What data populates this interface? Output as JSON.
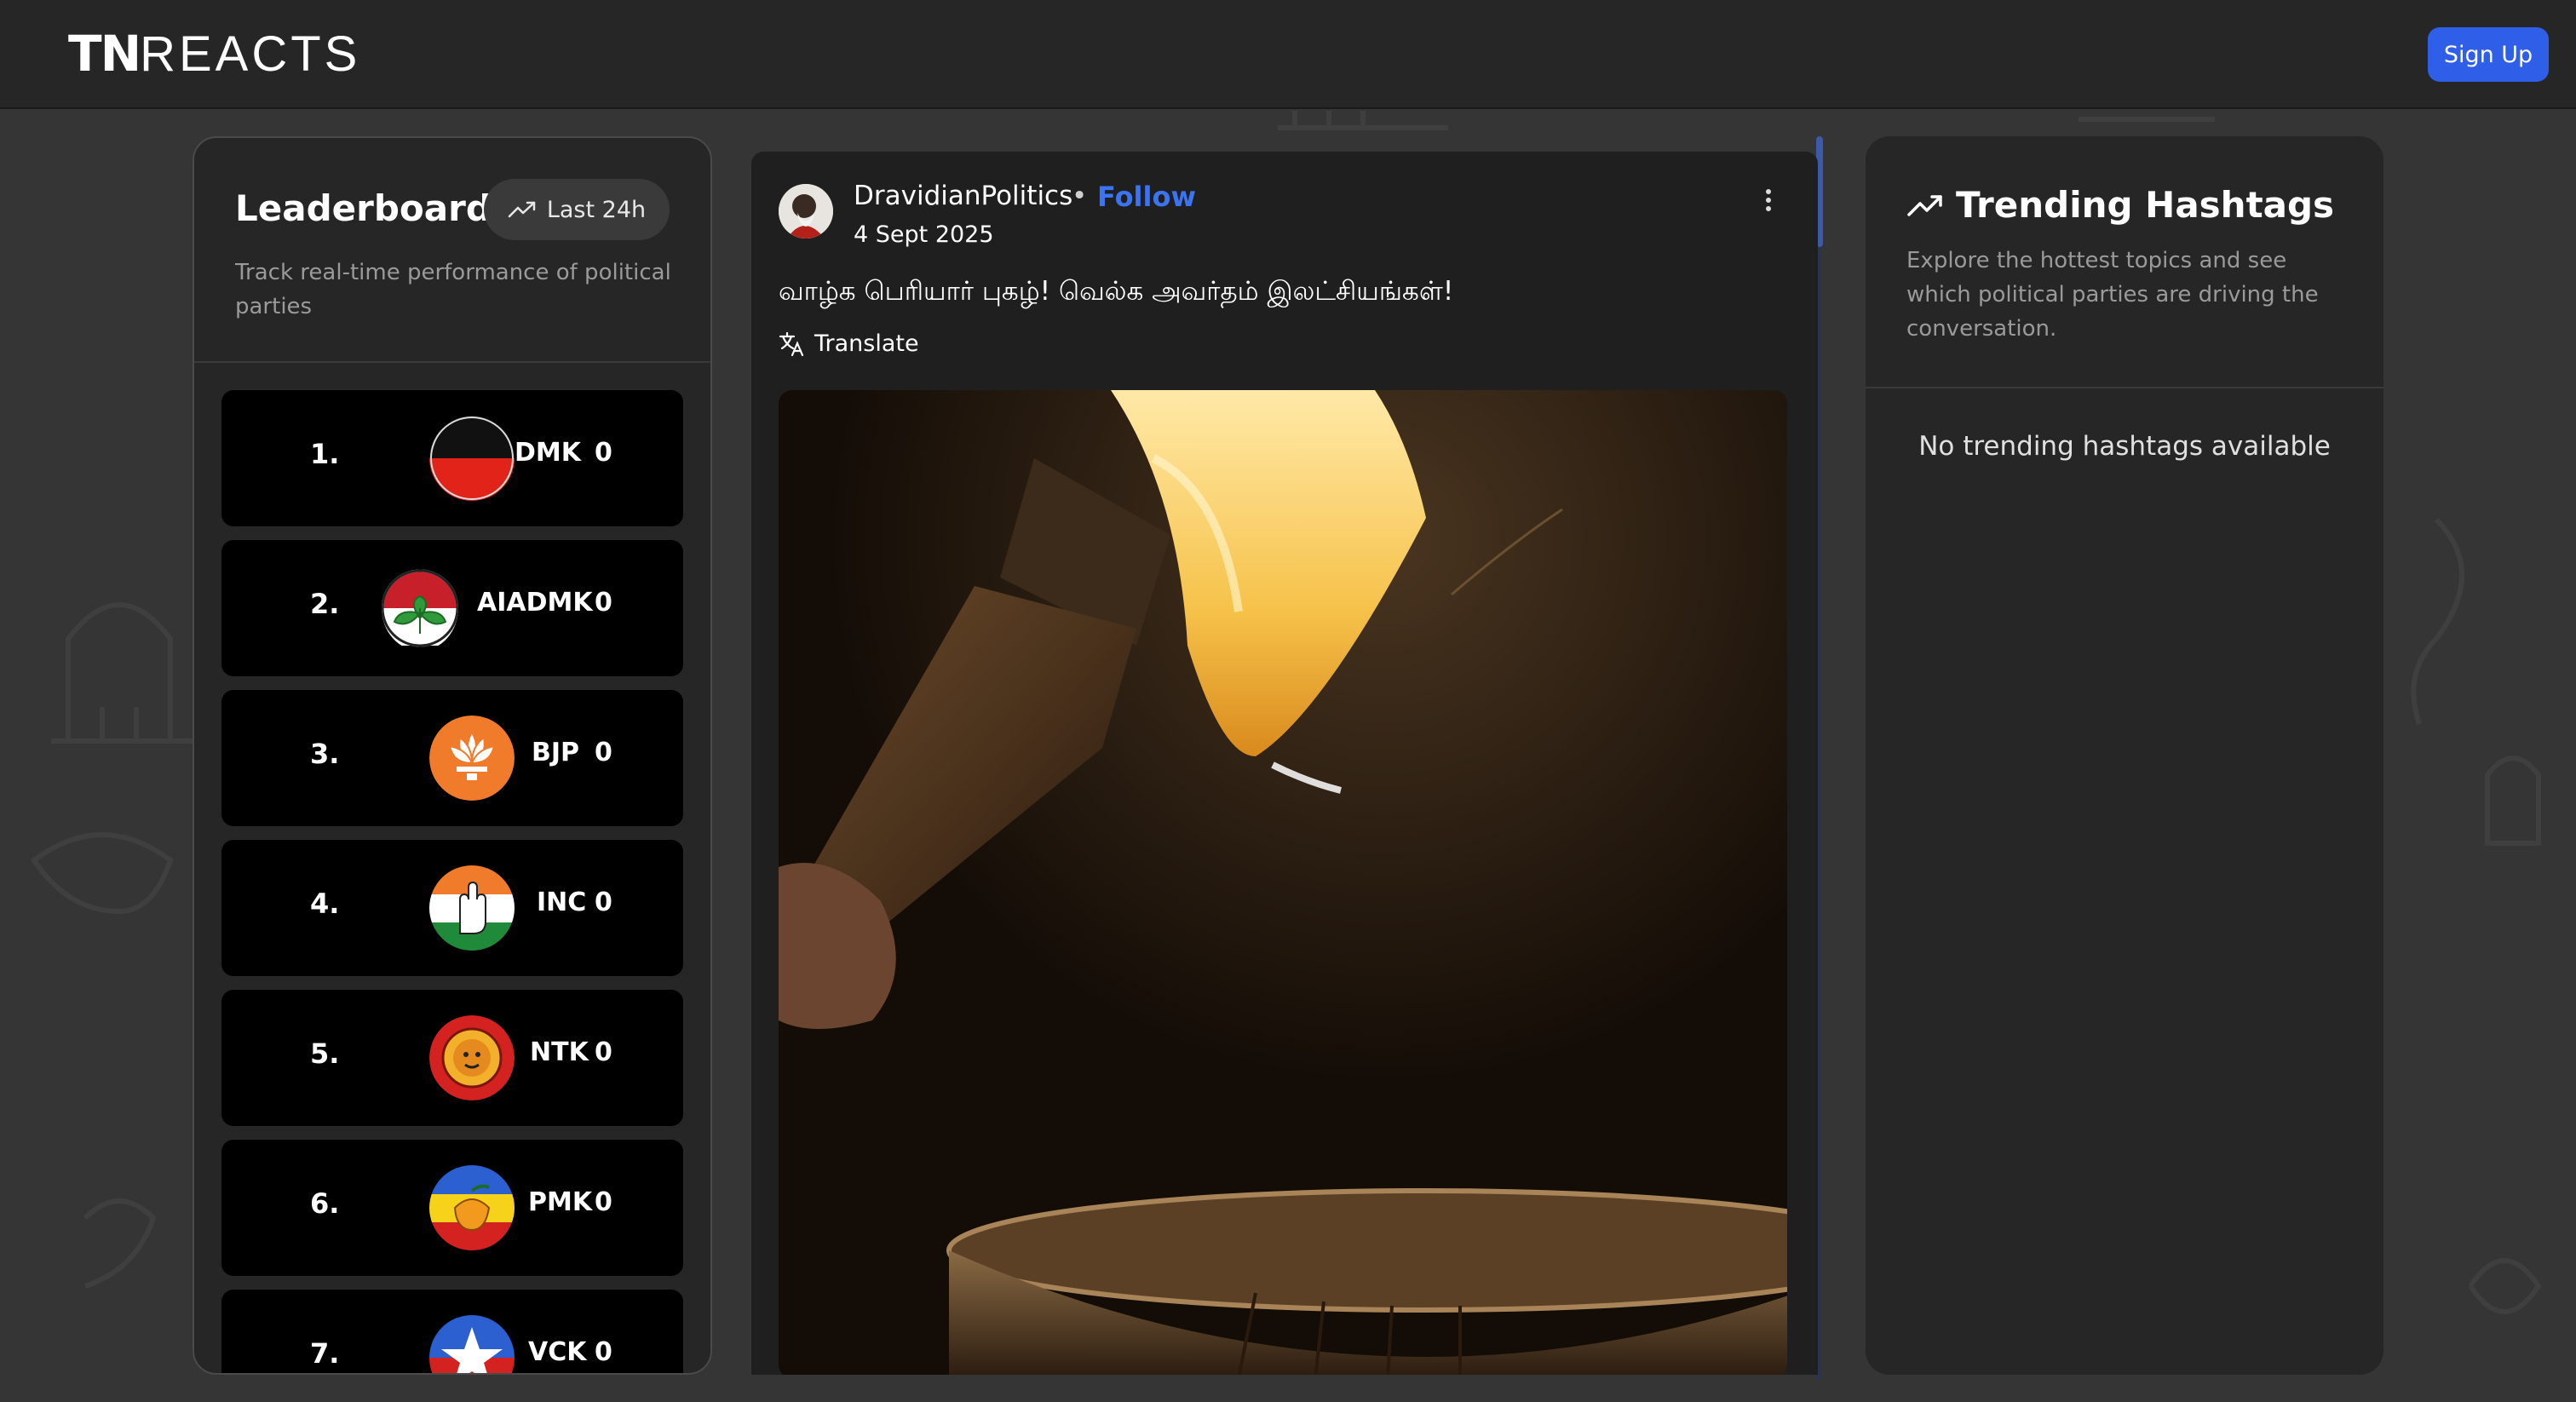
{
  "header": {
    "logo_bold": "TN",
    "logo_thin": "REACTS",
    "signup_label": "Sign Up"
  },
  "leaderboard": {
    "title": "Leaderboard",
    "filter_label": "Last 24h",
    "subtitle": "Track real-time performance of political parties",
    "rows": [
      {
        "rank": "1.",
        "party": "DMK",
        "score": "0",
        "logo": "dmk-flag-icon"
      },
      {
        "rank": "2.",
        "party": "AIADMK",
        "score": "0",
        "logo": "aiadmk-leaves-icon"
      },
      {
        "rank": "3.",
        "party": "BJP",
        "score": "0",
        "logo": "bjp-lotus-icon"
      },
      {
        "rank": "4.",
        "party": "INC",
        "score": "0",
        "logo": "inc-hand-icon"
      },
      {
        "rank": "5.",
        "party": "NTK",
        "score": "0",
        "logo": "ntk-tiger-icon"
      },
      {
        "rank": "6.",
        "party": "PMK",
        "score": "0",
        "logo": "pmk-mango-icon"
      },
      {
        "rank": "7.",
        "party": "VCK",
        "score": "0",
        "logo": "vck-star-icon"
      }
    ]
  },
  "post": {
    "author": "DravidianPolitics",
    "separator": "•",
    "follow_label": "Follow",
    "date": "4 Sept 2025",
    "text": "வாழ்க பெரியார் புகழ்! வெல்க அவர்தம் இலட்சியங்கள்!",
    "translate_label": "Translate"
  },
  "trending": {
    "title": "Trending Hashtags",
    "subtitle": "Explore the hottest topics and see which political parties are driving the conversation.",
    "empty_message": "No trending hashtags available"
  },
  "colors": {
    "accent": "#2f5fe8",
    "follow": "#3b74f0",
    "panel": "#262626",
    "row": "#000000"
  }
}
